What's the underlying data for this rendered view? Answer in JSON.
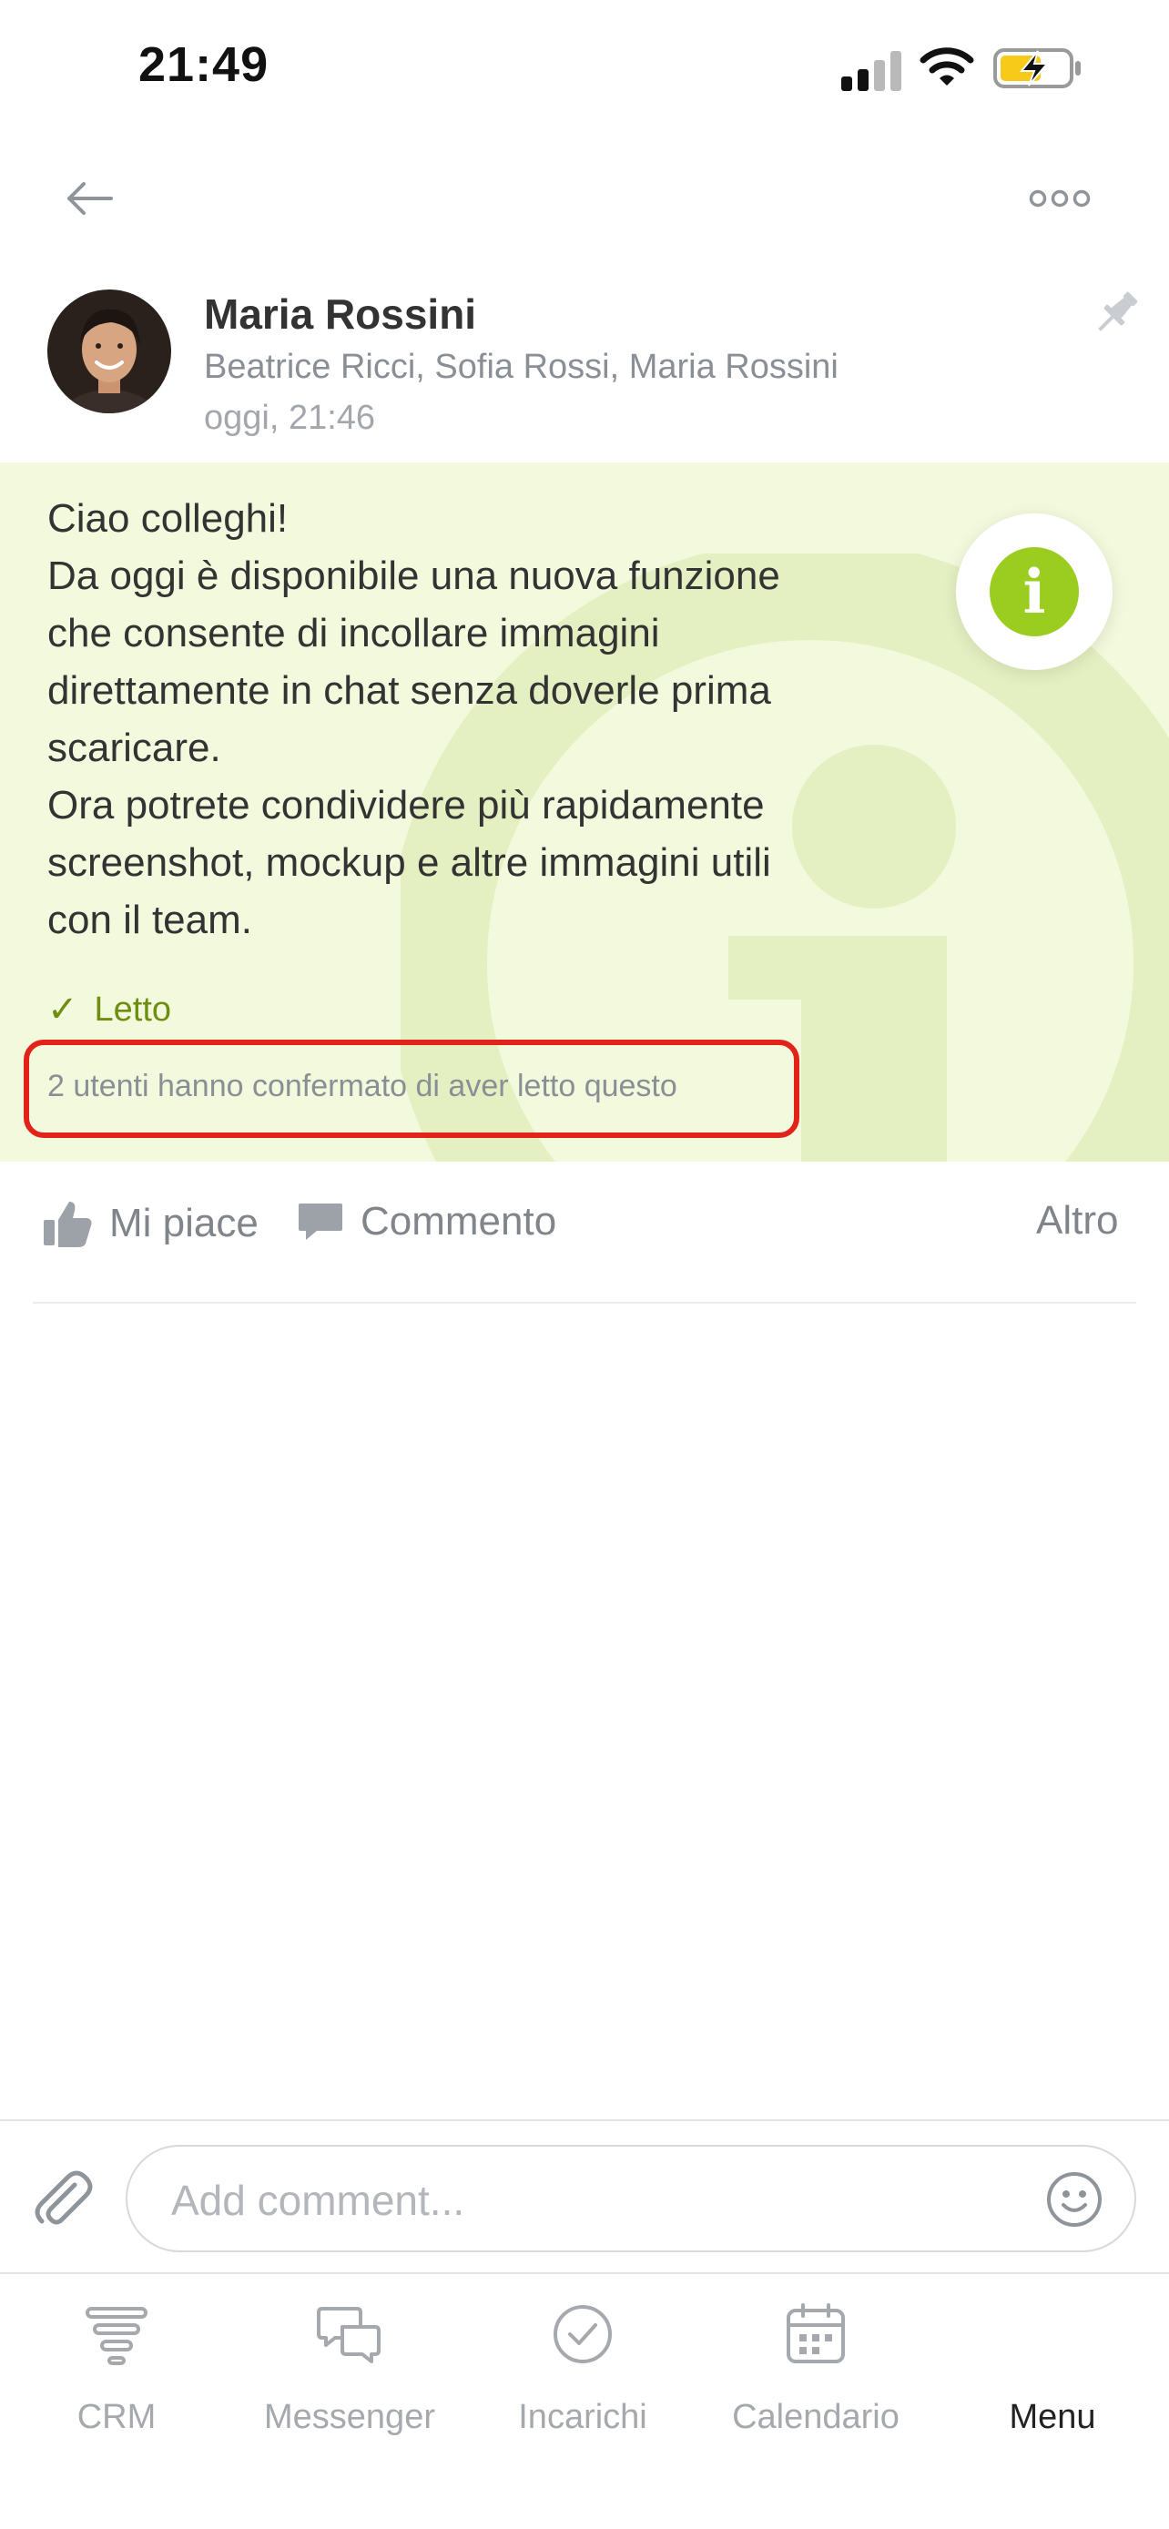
{
  "status_bar": {
    "time": "21:49"
  },
  "post": {
    "author": "Maria Rossini",
    "recipients": "Beatrice Ricci, Sofia Rossi, Maria Rossini",
    "time": "oggi, 21:46",
    "text": "Ciao colleghi!\nDa oggi è disponibile una nuova funzione\nche consente di incollare immagini\ndirettamente in chat senza doverle prima\nscaricare.\nOra potrete condividere più rapidamente\nscreenshot, mockup e altre immagini utili\ncon il team.",
    "read_status": "Letto",
    "confirmation": "2 utenti hanno confermato di aver letto questo",
    "accent_color": "#9acd1f",
    "card_color": "#f2f9dc"
  },
  "actions": {
    "like": "Mi piace",
    "comment": "Commento",
    "more": "Altro"
  },
  "comment_input": {
    "placeholder": "Add comment..."
  },
  "tabs": [
    {
      "label": "CRM",
      "icon": "crm-funnel-icon"
    },
    {
      "label": "Messenger",
      "icon": "chat-bubbles-icon"
    },
    {
      "label": "Incarichi",
      "icon": "check-circle-icon"
    },
    {
      "label": "Calendario",
      "icon": "calendar-icon"
    },
    {
      "label": "Menu",
      "icon": "avatar",
      "active": true
    }
  ]
}
